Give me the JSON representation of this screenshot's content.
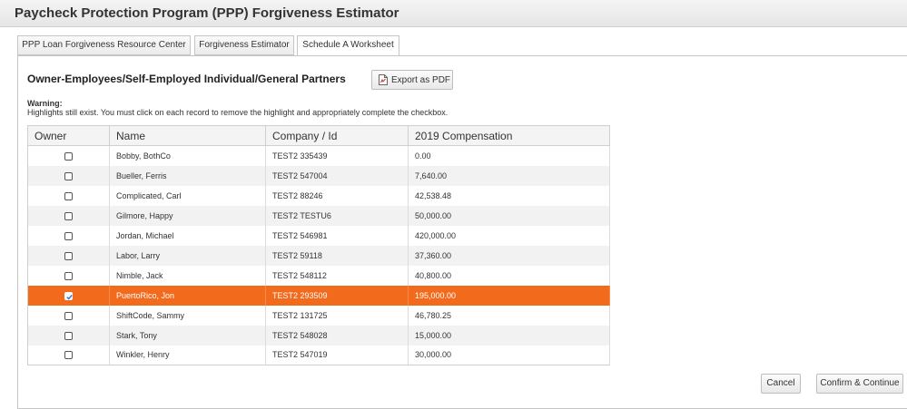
{
  "app": {
    "title": "Paycheck Protection Program (PPP) Forgiveness Estimator"
  },
  "tabs": [
    {
      "label": "PPP Loan Forgiveness Resource Center",
      "active": false
    },
    {
      "label": "Forgiveness Estimator",
      "active": false
    },
    {
      "label": "Schedule A Worksheet",
      "active": true
    }
  ],
  "section": {
    "title": "Owner-Employees/Self-Employed Individual/General Partners",
    "export_label": "Export as PDF",
    "export_icon": "pdf-icon"
  },
  "warning": {
    "title": "Warning:",
    "text": "Highlights still exist. You must click on each record to remove the highlight and appropriately complete the checkbox."
  },
  "table": {
    "columns": [
      "Owner",
      "Name",
      "Company / Id",
      "2019 Compensation"
    ],
    "rows": [
      {
        "owner": false,
        "name": "Bobby, BothCo",
        "company": "TEST2 335439",
        "comp": "0.00",
        "selected": false
      },
      {
        "owner": false,
        "name": "Bueller, Ferris",
        "company": "TEST2 547004",
        "comp": "7,640.00",
        "selected": false
      },
      {
        "owner": false,
        "name": "Complicated, Carl",
        "company": "TEST2 88246",
        "comp": "42,538.48",
        "selected": false
      },
      {
        "owner": false,
        "name": "Gilmore, Happy",
        "company": "TEST2 TESTU6",
        "comp": "50,000.00",
        "selected": false
      },
      {
        "owner": false,
        "name": "Jordan, Michael",
        "company": "TEST2 546981",
        "comp": "420,000.00",
        "selected": false
      },
      {
        "owner": false,
        "name": "Labor, Larry",
        "company": "TEST2 59118",
        "comp": "37,360.00",
        "selected": false
      },
      {
        "owner": false,
        "name": "Nimble, Jack",
        "company": "TEST2 548112",
        "comp": "40,800.00",
        "selected": false
      },
      {
        "owner": true,
        "name": "PuertoRico, Jon",
        "company": "TEST2 293509",
        "comp": "195,000.00",
        "selected": true
      },
      {
        "owner": false,
        "name": "ShiftCode, Sammy",
        "company": "TEST2 131725",
        "comp": "46,780.25",
        "selected": false
      },
      {
        "owner": false,
        "name": "Stark, Tony",
        "company": "TEST2 548028",
        "comp": "15,000.00",
        "selected": false
      },
      {
        "owner": false,
        "name": "Winkler, Henry",
        "company": "TEST2 547019",
        "comp": "30,000.00",
        "selected": false
      }
    ]
  },
  "footer": {
    "cancel_label": "Cancel",
    "confirm_label": "Confirm & Continue"
  },
  "colors": {
    "selected_row": "#f26b1d"
  }
}
